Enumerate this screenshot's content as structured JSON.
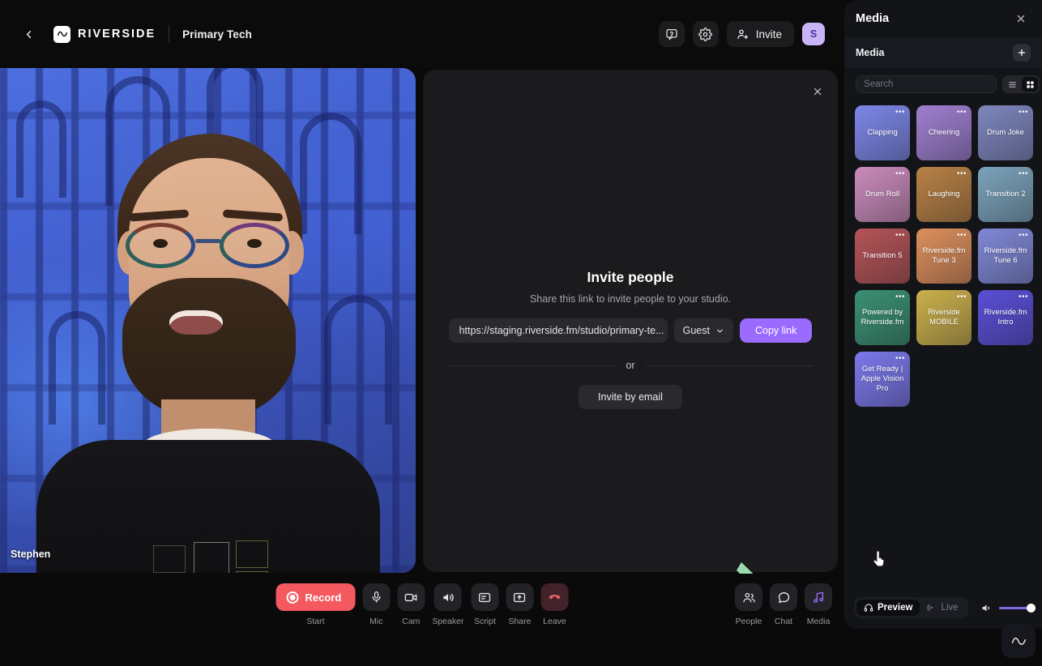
{
  "header": {
    "back_icon": "chevron-left-icon",
    "brand_name": "RIVERSIDE",
    "brand_mark_icon": "waveform-icon",
    "project_name": "Primary Tech",
    "help_icon": "help-chat-icon",
    "settings_icon": "gear-icon",
    "invite_label": "Invite",
    "invite_icon": "add-person-icon",
    "avatar_initial": "S",
    "avatar_color": "#c9b4f7"
  },
  "video": {
    "participant_name": "Stephen"
  },
  "invite_dialog": {
    "close_icon": "close-icon",
    "title": "Invite people",
    "subtitle": "Share this link to invite people to your studio.",
    "link_value": "https://staging.riverside.fm/studio/primary-te...",
    "role_selected": "Guest",
    "role_chevron_icon": "chevron-down-icon",
    "copy_label": "Copy link",
    "copy_color": "#9b6bff",
    "or_label": "or",
    "email_label": "Invite by email"
  },
  "toolbar": {
    "record": {
      "label": "Record",
      "sublabel": "Start",
      "icon": "record-circle-icon",
      "color": "#f4595f"
    },
    "items": [
      {
        "label": "Mic",
        "icon": "microphone-icon"
      },
      {
        "label": "Cam",
        "icon": "camera-icon"
      },
      {
        "label": "Speaker",
        "icon": "speaker-icon"
      },
      {
        "label": "Script",
        "icon": "script-icon"
      },
      {
        "label": "Share",
        "icon": "share-screen-icon"
      },
      {
        "label": "Leave",
        "icon": "phone-hangup-icon"
      }
    ],
    "right_items": [
      {
        "label": "People",
        "icon": "people-icon",
        "active": false
      },
      {
        "label": "Chat",
        "icon": "chat-bubble-icon",
        "active": false
      },
      {
        "label": "Media",
        "icon": "music-note-icon",
        "active": true
      }
    ]
  },
  "media_panel": {
    "title": "Media",
    "close_icon": "close-icon",
    "section_title": "Media",
    "add_icon": "plus-icon",
    "search_placeholder": "Search",
    "view_list_icon": "list-view-icon",
    "view_grid_icon": "grid-view-icon",
    "view_selected": "grid",
    "tile_menu_icon": "more-options-icon",
    "tiles": [
      {
        "label": "Clapping",
        "color": "#7d87e8"
      },
      {
        "label": "Cheering",
        "color": "#a07fd0"
      },
      {
        "label": "Drum Joke",
        "color": "#7e86bd"
      },
      {
        "label": "Drum Roll",
        "color": "#ca8bbb"
      },
      {
        "label": "Laughing",
        "color": "#b88145"
      },
      {
        "label": "Transition 2",
        "color": "#7ba3bb"
      },
      {
        "label": "Transition 5",
        "color": "#b45457"
      },
      {
        "label": "Riverside.fm Tune 3",
        "color": "#dd8f5c"
      },
      {
        "label": "Riverside.fm Tune 6",
        "color": "#8088d6"
      },
      {
        "label": "Powered by Riverside.fm",
        "color": "#3b9073"
      },
      {
        "label": "Riverside MOBILE",
        "color": "#cbb04c"
      },
      {
        "label": "Riverside.fm Intro",
        "color": "#5a4fd6"
      },
      {
        "label": "Get Ready | Apple Vision Pro",
        "color": "#7b78ea"
      }
    ],
    "footer": {
      "preview_label": "Preview",
      "preview_icon": "headphones-icon",
      "live_label": "Live",
      "live_icon": "broadcast-icon",
      "selected": "Preview",
      "volume_icon": "volume-icon",
      "volume_percent": 100,
      "volume_color": "#8067e0"
    }
  },
  "annotations": {
    "arrow_color": "#9bd9b0",
    "arrow_name": "pointer-arrow"
  },
  "floating": {
    "waveform_icon": "waveform-icon"
  }
}
